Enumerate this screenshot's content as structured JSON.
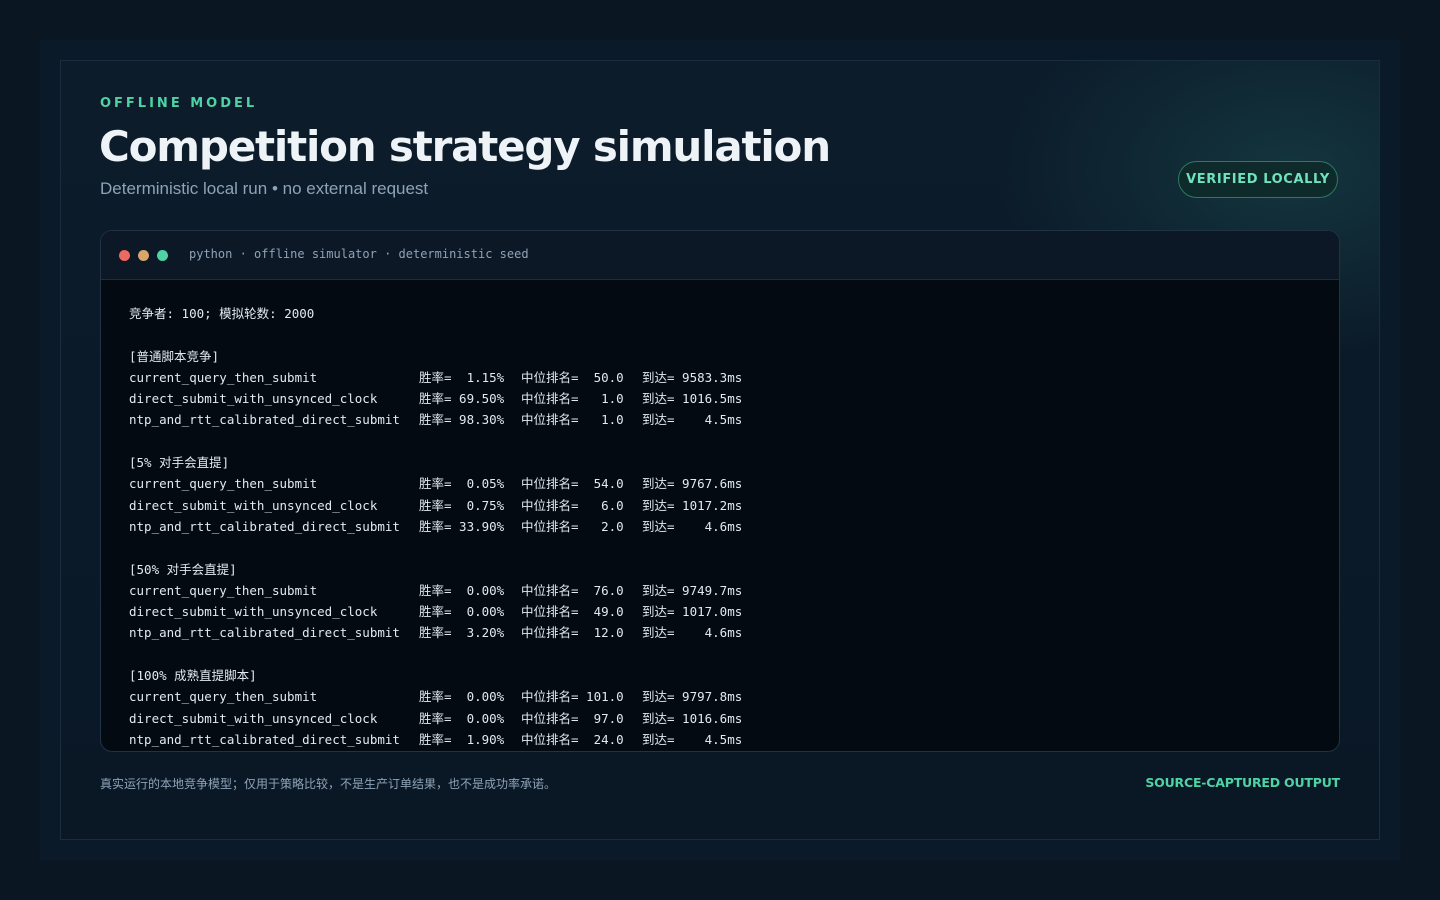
{
  "header": {
    "eyebrow": "OFFLINE MODEL",
    "title": "Competition strategy simulation",
    "subtitle": "Deterministic local run • no external request",
    "badge": "VERIFIED LOCALLY"
  },
  "terminal": {
    "title": "python · offline simulator · deterministic seed",
    "summary": "竞争者: 100; 模拟轮数: 2000",
    "groups": [
      {
        "heading": "[普通脚本竞争]",
        "rows": [
          {
            "name": "current_query_then_submit",
            "win": "胜率=  1.15%",
            "rank": "中位排名=  50.0",
            "arrive": "到达= 9583.3ms"
          },
          {
            "name": "direct_submit_with_unsynced_clock",
            "win": "胜率= 69.50%",
            "rank": "中位排名=   1.0",
            "arrive": "到达= 1016.5ms"
          },
          {
            "name": "ntp_and_rtt_calibrated_direct_submit",
            "win": "胜率= 98.30%",
            "rank": "中位排名=   1.0",
            "arrive": "到达=    4.5ms"
          }
        ]
      },
      {
        "heading": "[5% 对手会直提]",
        "rows": [
          {
            "name": "current_query_then_submit",
            "win": "胜率=  0.05%",
            "rank": "中位排名=  54.0",
            "arrive": "到达= 9767.6ms"
          },
          {
            "name": "direct_submit_with_unsynced_clock",
            "win": "胜率=  0.75%",
            "rank": "中位排名=   6.0",
            "arrive": "到达= 1017.2ms"
          },
          {
            "name": "ntp_and_rtt_calibrated_direct_submit",
            "win": "胜率= 33.90%",
            "rank": "中位排名=   2.0",
            "arrive": "到达=    4.6ms"
          }
        ]
      },
      {
        "heading": "[50% 对手会直提]",
        "rows": [
          {
            "name": "current_query_then_submit",
            "win": "胜率=  0.00%",
            "rank": "中位排名=  76.0",
            "arrive": "到达= 9749.7ms"
          },
          {
            "name": "direct_submit_with_unsynced_clock",
            "win": "胜率=  0.00%",
            "rank": "中位排名=  49.0",
            "arrive": "到达= 1017.0ms"
          },
          {
            "name": "ntp_and_rtt_calibrated_direct_submit",
            "win": "胜率=  3.20%",
            "rank": "中位排名=  12.0",
            "arrive": "到达=    4.6ms"
          }
        ]
      },
      {
        "heading": "[100% 成熟直提脚本]",
        "rows": [
          {
            "name": "current_query_then_submit",
            "win": "胜率=  0.00%",
            "rank": "中位排名= 101.0",
            "arrive": "到达= 9797.8ms"
          },
          {
            "name": "direct_submit_with_unsynced_clock",
            "win": "胜率=  0.00%",
            "rank": "中位排名=  97.0",
            "arrive": "到达= 1016.6ms"
          },
          {
            "name": "ntp_and_rtt_calibrated_direct_submit",
            "win": "胜率=  1.90%",
            "rank": "中位排名=  24.0",
            "arrive": "到达=    4.5ms"
          }
        ]
      }
    ]
  },
  "footer": {
    "note": "真实运行的本地竞争模型；仅用于策略比较，不是生产订单结果，也不是成功率承诺。",
    "tag": "SOURCE-CAPTURED OUTPUT"
  },
  "colors": {
    "accent": "#4fd3a4",
    "background": "#0a1622",
    "terminal_bg": "#030a12"
  }
}
